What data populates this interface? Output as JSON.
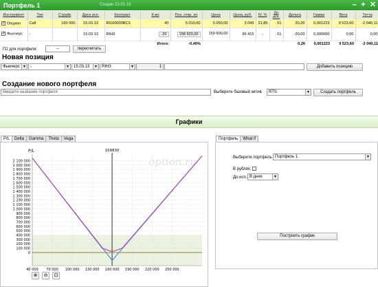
{
  "window": {
    "title": "Портфель 1",
    "created": "Создан 23.01.13"
  },
  "table": {
    "headers": [
      "Инструмент",
      "Тип",
      "Страйк",
      "Дата исп.",
      "Контракт",
      "К-во",
      "Поз. откр. по",
      "Цена",
      "Цена, руб.",
      "IV, %",
      "До исп.",
      "Дельта",
      "Гамма",
      "Вега",
      "Тетта",
      "+/-"
    ],
    "rows": [
      {
        "instrument": "Опцион",
        "type": "Call",
        "strike": "160 000",
        "date": "15.03.13",
        "contract": "RI160000BC3",
        "qty": "40",
        "pos": "5 010,00",
        "price": "5 050,00",
        "price_rub": "3 049",
        "iv": "21,85",
        "days": "51",
        "delta": "20,26",
        "gamma": "0,001223",
        "vega": "9 523,60",
        "theta": "-2 040,11"
      },
      {
        "instrument": "Фьючерс",
        "type": "-",
        "strike": "",
        "date": "15.03.13",
        "contract": "RIH3",
        "qty": "-20",
        "pos": "158 920,00",
        "price": "159 600,00",
        "price_rub": "96 415",
        "iv": "-",
        "days": "51",
        "delta": "-20,00",
        "gamma": "0,000000",
        "vega": "0,00",
        "theta": "0,00"
      }
    ],
    "totals": {
      "label": "Итого:",
      "pos": "-0,40%",
      "delta": "0,26",
      "gamma": "0,001223",
      "vega": "9 523,60",
      "theta": "-2 040,11"
    }
  },
  "go": {
    "label": "ГО для портфеля:",
    "value": "--",
    "recalc": "пересчитать"
  },
  "new_position": {
    "title": "Новая позиция",
    "instrument": "Фьючерс",
    "type": "-",
    "date": "15.03.13",
    "contract": "RIH3",
    "qty": "1",
    "add_button": "Добавить позицию"
  },
  "new_portfolio": {
    "title": "Создание нового портфеля",
    "name_placeholder": "Введите название портфеля",
    "asset_label": "Выберите базовый актив",
    "asset_value": "RTS",
    "create_button": "Создать портфель"
  },
  "graphs": {
    "title": "Графики"
  },
  "chart_tabs": [
    "P/L",
    "Delta",
    "Gamma",
    "Theta",
    "Vega"
  ],
  "right_tabs": [
    "Портфель",
    "What if"
  ],
  "right_panel": {
    "portfolio_label": "Выберите портфель",
    "portfolio_value": "Портфель 1",
    "rub_label": "В рублях:",
    "till_label": "До исп.:",
    "till_value": "В днях",
    "build_button": "Построить график"
  },
  "chart_data": {
    "type": "line",
    "ylabel": "P/L",
    "watermark": "option.ru",
    "marker_label": "159830",
    "marker_x": 159830,
    "xlim": [
      40000,
      295000
    ],
    "ylim": [
      -300000,
      2250000
    ],
    "x_ticks": [
      40000,
      70000,
      100000,
      130000,
      160000,
      190000,
      220000,
      250000
    ],
    "x_tick_labels": [
      "40 000",
      "70 000",
      "100 000",
      "130 000",
      "160 000",
      "190 000",
      "220 000",
      "250 000"
    ],
    "y_ticks": [
      0,
      100000,
      200000,
      300000,
      400000,
      500000,
      600000,
      700000,
      800000,
      900000,
      1000000,
      1100000,
      1200000,
      1300000,
      1400000,
      1500000,
      1600000,
      1700000,
      1800000,
      1900000,
      2000000,
      2100000
    ],
    "y_tick_labels": [
      "0",
      "100 000",
      "200 000",
      "300 000",
      "400 000",
      "500 000",
      "600 000",
      "700 000",
      "800 000",
      "900 000",
      "1 000 000",
      "1 100 000",
      "1 200 000",
      "1 300 000",
      "1 400 000",
      "1 500 000",
      "1 600 000",
      "1 700 000",
      "1 800 000",
      "1 900 000",
      "2 000 000",
      "2 100 000"
    ],
    "series": [
      {
        "color": "#4a7fe0",
        "x": [
          40000,
          160000,
          295000
        ],
        "y": [
          2160000,
          -180000,
          2210000
        ]
      },
      {
        "color": "#b040b0",
        "x": [
          40000,
          145000,
          160000,
          175000,
          295000
        ],
        "y": [
          2160000,
          100000,
          20000,
          100000,
          2210000
        ]
      },
      {
        "color": "#9b8a4a",
        "x": [
          40000,
          295000
        ],
        "y": [
          0,
          0
        ]
      }
    ]
  }
}
